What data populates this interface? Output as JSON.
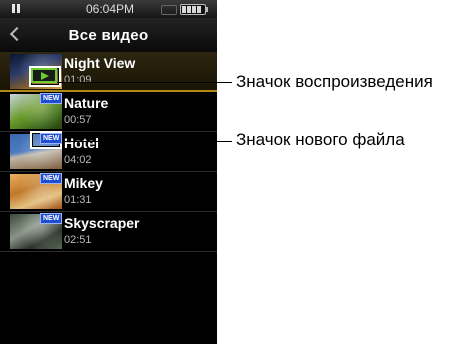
{
  "status": {
    "time": "06:04PM",
    "pause_icon": "pause-icon",
    "hold_icon": "hold-icon",
    "battery_icon": "battery-icon"
  },
  "header": {
    "title": "Все видео"
  },
  "videos": [
    {
      "name": "Night View",
      "duration": "01:09",
      "is_new": false,
      "playing": true,
      "selected": true
    },
    {
      "name": "Nature",
      "duration": "00:57",
      "is_new": true,
      "new_label": "NEW",
      "playing": false
    },
    {
      "name": "Hotel",
      "duration": "04:02",
      "is_new": true,
      "new_label": "NEW",
      "playing": false
    },
    {
      "name": "Mikey",
      "duration": "01:31",
      "is_new": true,
      "new_label": "NEW",
      "playing": false
    },
    {
      "name": "Skyscraper",
      "duration": "02:51",
      "is_new": true,
      "new_label": "NEW",
      "playing": false
    }
  ],
  "callouts": {
    "playback_icon": "Значок воспроизведения",
    "new_file_icon": "Значок нового файла"
  }
}
